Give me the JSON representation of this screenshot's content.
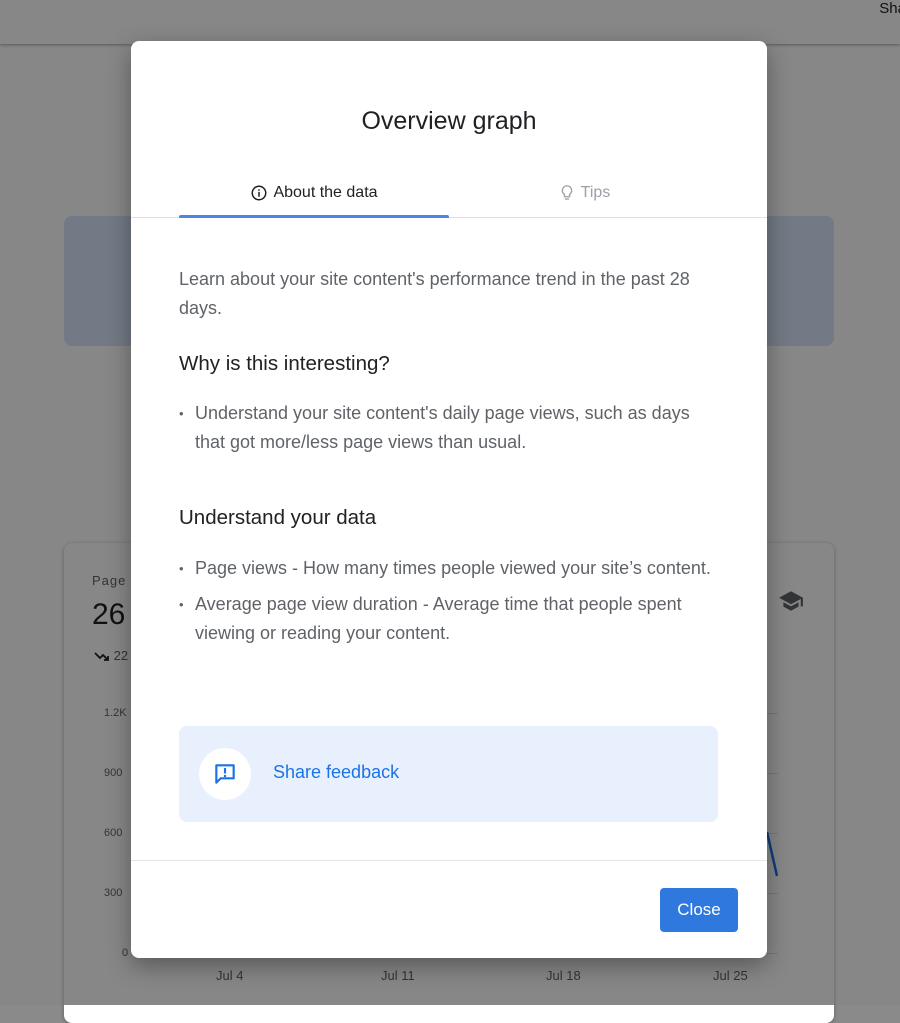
{
  "background": {
    "share_label": "Sha",
    "metric_label": "Page",
    "metric_value": "26",
    "trend_value": "22",
    "y_ticks": [
      "1.2K",
      "900",
      "600",
      "300",
      "0"
    ],
    "x_ticks": [
      "Jul 4",
      "Jul 11",
      "Jul 18",
      "Jul 25"
    ]
  },
  "dialog": {
    "title": "Overview graph",
    "tabs": [
      {
        "label": "About the data",
        "icon": "info-icon",
        "active": true
      },
      {
        "label": "Tips",
        "icon": "lightbulb-icon",
        "active": false
      }
    ],
    "intro": "Learn about your site content's performance trend in the past 28 days.",
    "sections": [
      {
        "title": "Why is this interesting?",
        "items": [
          "Understand your site content's daily page views, such as days that got more/less page views than usual."
        ]
      },
      {
        "title": "Understand your data",
        "items": [
          "Page views - How many times people viewed your site’s content.",
          "Average page view duration - Average time that people spent viewing or reading your content."
        ]
      }
    ],
    "feedback": {
      "label": "Share feedback",
      "icon": "feedback-icon"
    },
    "close_label": "Close"
  },
  "colors": {
    "accent": "#1a73e8",
    "button": "#2f78de",
    "feedback_bg": "#e8f0fe",
    "tab_indicator": "#4a86e8"
  }
}
